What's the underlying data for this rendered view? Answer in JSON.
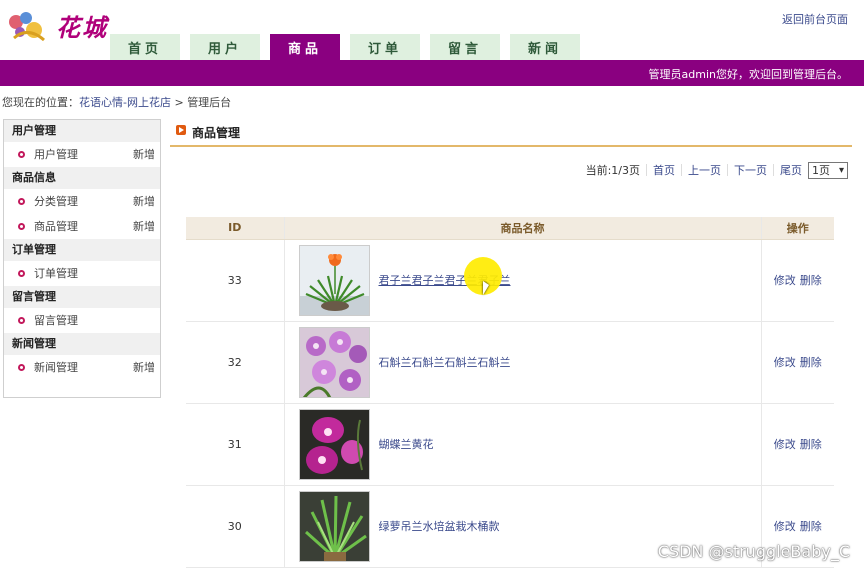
{
  "header": {
    "logo_text": "花城",
    "back_link": "返回前台页面",
    "welcome": "管理员admin您好，欢迎回到管理后台。"
  },
  "nav": {
    "tabs": [
      {
        "label": "首页",
        "active": false
      },
      {
        "label": "用户",
        "active": false
      },
      {
        "label": "商品",
        "active": true
      },
      {
        "label": "订单",
        "active": false
      },
      {
        "label": "留言",
        "active": false
      },
      {
        "label": "新闻",
        "active": false
      }
    ]
  },
  "breadcrumb": {
    "prefix": "您现在的位置：",
    "site": "花语心情-网上花店",
    "separator": " > ",
    "current": "管理后台"
  },
  "sidebar": {
    "groups": [
      {
        "title": "用户管理",
        "items": [
          {
            "label": "用户管理",
            "add": "新增"
          }
        ]
      },
      {
        "title": "商品信息",
        "items": [
          {
            "label": "分类管理",
            "add": "新增"
          },
          {
            "label": "商品管理",
            "add": "新增"
          }
        ]
      },
      {
        "title": "订单管理",
        "items": [
          {
            "label": "订单管理",
            "add": ""
          }
        ]
      },
      {
        "title": "留言管理",
        "items": [
          {
            "label": "留言管理",
            "add": ""
          }
        ]
      },
      {
        "title": "新闻管理",
        "items": [
          {
            "label": "新闻管理",
            "add": "新增"
          }
        ]
      }
    ]
  },
  "main": {
    "title": "商品管理",
    "pager": {
      "current": "当前:1/3页",
      "first": "首页",
      "prev": "上一页",
      "next": "下一页",
      "last": "尾页",
      "select_value": "1页"
    },
    "table": {
      "headers": {
        "id": "ID",
        "name": "商品名称",
        "op": "操作"
      },
      "rows": [
        {
          "id": "33",
          "name": "君子兰君子兰君子兰君子兰",
          "edit": "修改",
          "delete": "删除",
          "image": "clivia"
        },
        {
          "id": "32",
          "name": "石斛兰石斛兰石斛兰石斛兰",
          "edit": "修改",
          "delete": "删除",
          "image": "dendrobium"
        },
        {
          "id": "31",
          "name": "蝴蝶兰黄花",
          "edit": "修改",
          "delete": "删除",
          "image": "phalaenopsis"
        },
        {
          "id": "30",
          "name": "绿萝吊兰水培盆栽木桶款",
          "edit": "修改",
          "delete": "删除",
          "image": "spider-plant"
        }
      ]
    }
  },
  "watermark": "CSDN @struggleBaby_C",
  "colors": {
    "brand_purple": "#8a0080",
    "tab_green": "#dff0df",
    "link_blue": "#3b4a8c",
    "accent_gold": "#e3b86a"
  }
}
